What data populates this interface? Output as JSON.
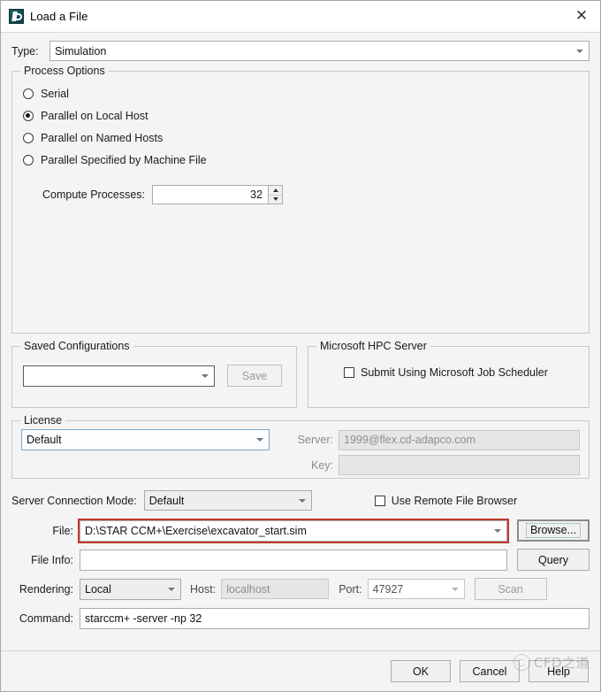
{
  "window": {
    "title": "Load a File",
    "icon": "star-ccm-app-icon",
    "close_label": "✕"
  },
  "type_row": {
    "label": "Type:",
    "value": "Simulation"
  },
  "process_options": {
    "legend": "Process Options",
    "radios": [
      {
        "label": "Serial",
        "checked": false
      },
      {
        "label": "Parallel on Local Host",
        "checked": true
      },
      {
        "label": "Parallel on Named Hosts",
        "checked": false
      },
      {
        "label": "Parallel Specified by Machine File",
        "checked": false
      }
    ],
    "compute_processes": {
      "label": "Compute Processes:",
      "value": "32"
    }
  },
  "saved_configurations": {
    "legend": "Saved Configurations",
    "combo_value": "",
    "save_label": "Save",
    "save_disabled": true
  },
  "hpc_server": {
    "legend": "Microsoft HPC Server",
    "checkbox_label": "Submit Using Microsoft Job Scheduler",
    "checked": false
  },
  "license": {
    "legend": "License",
    "combo_value": "Default",
    "server_label": "Server:",
    "server_value": "1999@flex.cd-adapco.com",
    "key_label": "Key:",
    "key_value": ""
  },
  "server_connection": {
    "label": "Server Connection Mode:",
    "value": "Default",
    "remote_browser_label": "Use Remote File Browser",
    "remote_browser_checked": false
  },
  "file_row": {
    "label": "File:",
    "value": "D:\\STAR CCM+\\Exercise\\excavator_start.sim",
    "browse_label": "Browse...",
    "highlight_color": "#c0392b"
  },
  "file_info_row": {
    "label": "File Info:",
    "value": "",
    "query_label": "Query"
  },
  "rendering_row": {
    "label": "Rendering:",
    "value": "Local",
    "host_label": "Host:",
    "host_value": "localhost",
    "host_disabled": true,
    "port_label": "Port:",
    "port_value": "47927",
    "port_disabled": true,
    "scan_label": "Scan",
    "scan_disabled": true
  },
  "command_row": {
    "label": "Command:",
    "value": "starccm+ -server -np 32"
  },
  "footer": {
    "ok_label": "OK",
    "cancel_label": "Cancel",
    "help_label": "Help"
  },
  "watermark": {
    "text": "CFD之道"
  }
}
